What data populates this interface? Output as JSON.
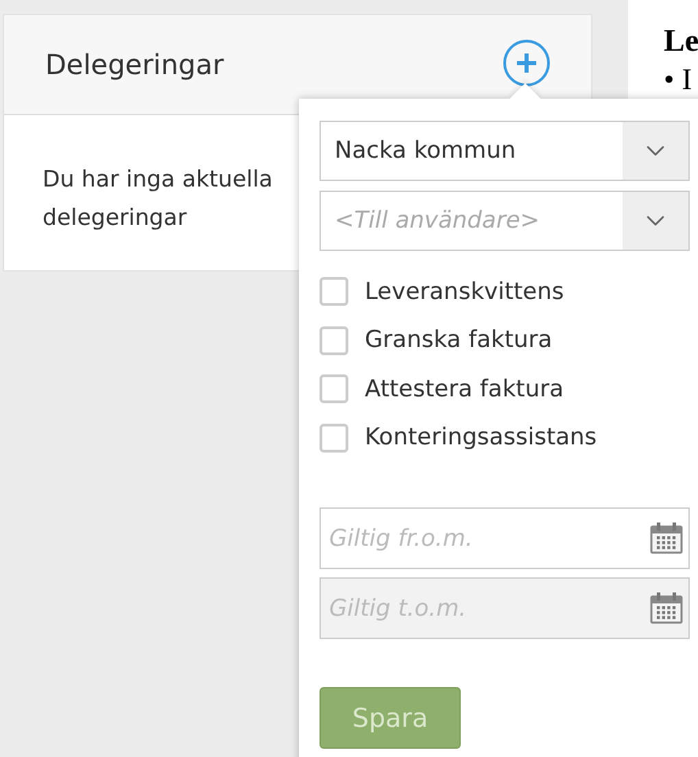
{
  "card": {
    "title": "Delegeringar",
    "message": "Du har inga aktuella delegeringar"
  },
  "side": {
    "heading": "Le",
    "bullet": "• I"
  },
  "popup": {
    "selects": [
      {
        "value": "Nacka kommun"
      },
      {
        "placeholder": "<Till användare>"
      }
    ],
    "checkboxes": [
      {
        "label": "Leveranskvittens",
        "checked": false
      },
      {
        "label": "Granska faktura",
        "checked": false
      },
      {
        "label": "Attestera faktura",
        "checked": false
      },
      {
        "label": "Konteringsassistans",
        "checked": false
      }
    ],
    "dates": [
      {
        "placeholder": "Giltig fr.o.m.",
        "disabled": false
      },
      {
        "placeholder": "Giltig t.o.m.",
        "disabled": true
      }
    ],
    "button": {
      "label": "Spara",
      "disabled": true
    }
  }
}
